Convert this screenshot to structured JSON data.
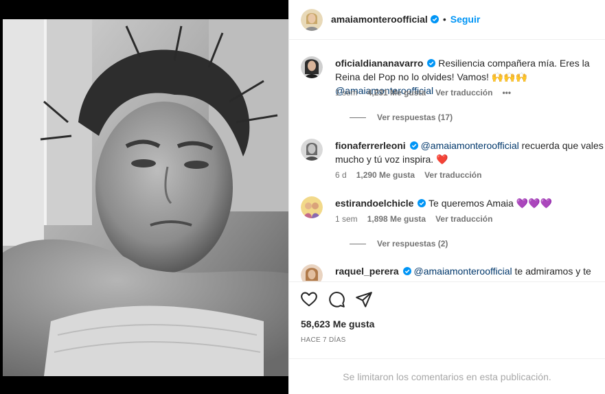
{
  "post": {
    "author": "amaiamonteroofficial",
    "follow_label": "Seguir",
    "separator": "•"
  },
  "comments": [
    {
      "user": "oficialdiananavarro",
      "text": "Resiliencia compañera mía. Eres la Reina del Pop no lo olvides! Vamos! 🙌🙌🙌 ",
      "mention": "@amaiamonteroofficial",
      "time": "1 sem",
      "likes": "4,231 Me gusta",
      "translate": "Ver traducción",
      "more": "•••",
      "replies": "Ver respuestas (17)"
    },
    {
      "user": "fionaferrerleoni",
      "mention": "@amaiamonteroofficial",
      "text": " recuerda que vales mucho y tú voz inspira. ",
      "emoji": "❤️",
      "time": "6 d",
      "likes": "1,290 Me gusta",
      "translate": "Ver traducción"
    },
    {
      "user": "estirandoelchicle",
      "text": "Te queremos Amaia ",
      "emoji": "💜💜💜",
      "time": "1 sem",
      "likes": "1,898 Me gusta",
      "translate": "Ver traducción",
      "replies": "Ver respuestas (2)"
    },
    {
      "user": "raquel_perera",
      "mention": "@amaiamonteroofficial",
      "text": " te admiramos y te"
    }
  ],
  "actions": {
    "like_count": "58,623 Me gusta",
    "date": "HACE 7 DÍAS",
    "comments_disabled": "Se limitaron los comentarios en esta publicación."
  },
  "colors": {
    "accent": "#0095f6",
    "verified": "#0095f6",
    "mention": "#00376b",
    "muted": "#737373"
  },
  "icons": [
    "heart-icon",
    "comment-icon",
    "share-icon",
    "verified-icon"
  ]
}
